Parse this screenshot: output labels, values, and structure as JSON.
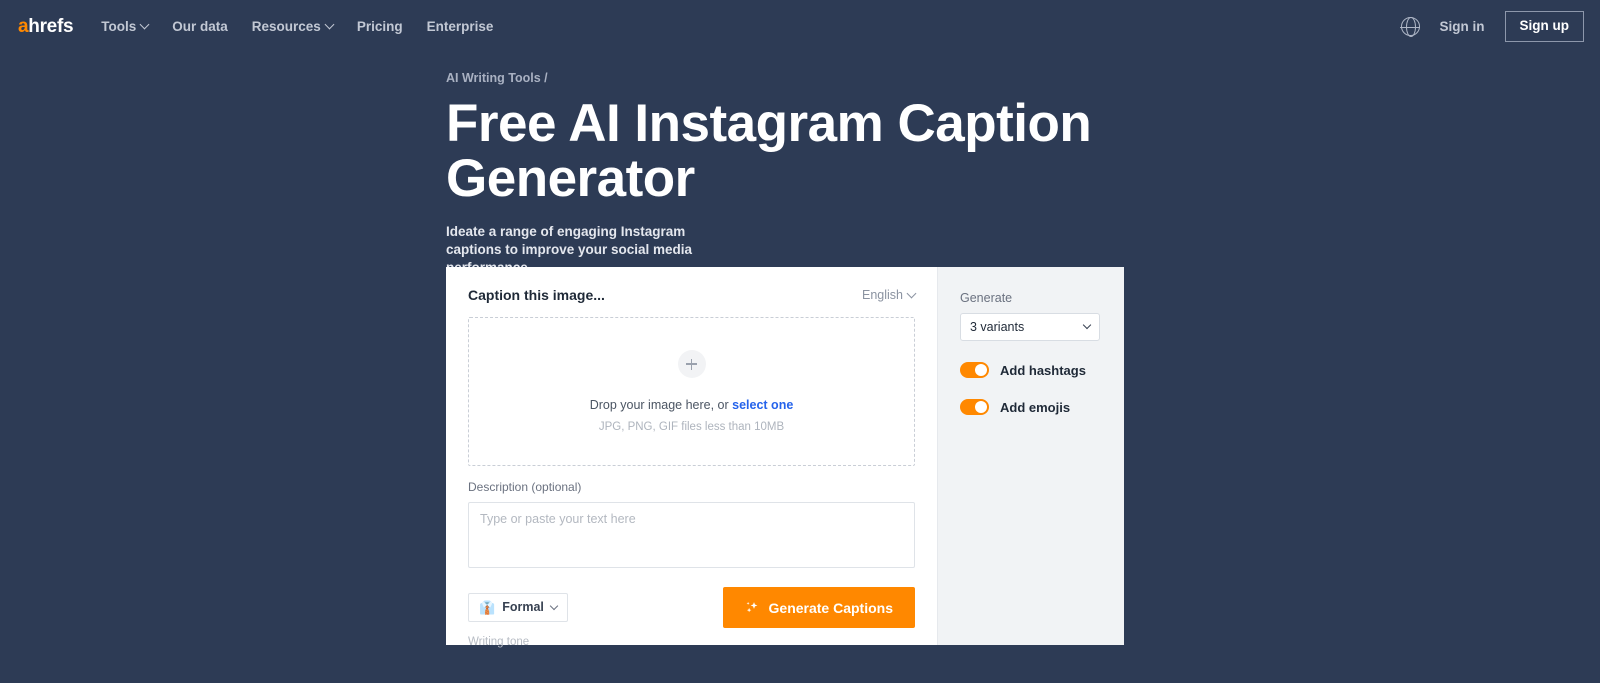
{
  "nav": {
    "logo_a": "a",
    "logo_rest": "hrefs",
    "links": [
      {
        "label": "Tools",
        "has_chevron": true
      },
      {
        "label": "Our data",
        "has_chevron": false
      },
      {
        "label": "Resources",
        "has_chevron": true
      },
      {
        "label": "Pricing",
        "has_chevron": false
      },
      {
        "label": "Enterprise",
        "has_chevron": false
      }
    ],
    "globe_icon": "globe-icon",
    "sign_in": "Sign in",
    "sign_up": "Sign up"
  },
  "hero": {
    "breadcrumb": "AI Writing Tools /",
    "title": "Free AI Instagram Caption Generator",
    "subtitle": "Ideate a range of engaging Instagram captions to improve your social media performance."
  },
  "tool": {
    "card_title": "Caption this image...",
    "language": "English",
    "dropzone": {
      "plus_icon": "plus-circle-icon",
      "prompt_text": "Drop your image here, or ",
      "prompt_link": "select one",
      "hint": "JPG, PNG, GIF files less than 10MB"
    },
    "description": {
      "label": "Description (optional)",
      "placeholder": "Type or paste your text here",
      "value": ""
    },
    "tone": {
      "emoji": "👔",
      "value": "Formal",
      "helper": "Writing tone"
    },
    "generate_button": {
      "icon": "sparkles-icon",
      "label": "Generate Captions"
    }
  },
  "settings": {
    "generate_label": "Generate",
    "variants_value": "3 variants",
    "toggles": [
      {
        "label": "Add hashtags",
        "on": true
      },
      {
        "label": "Add emojis",
        "on": true
      }
    ]
  },
  "colors": {
    "page_bg": "#2d3b55",
    "accent": "#ff8800",
    "link": "#2563eb",
    "panel_bg": "#f1f3f5"
  }
}
